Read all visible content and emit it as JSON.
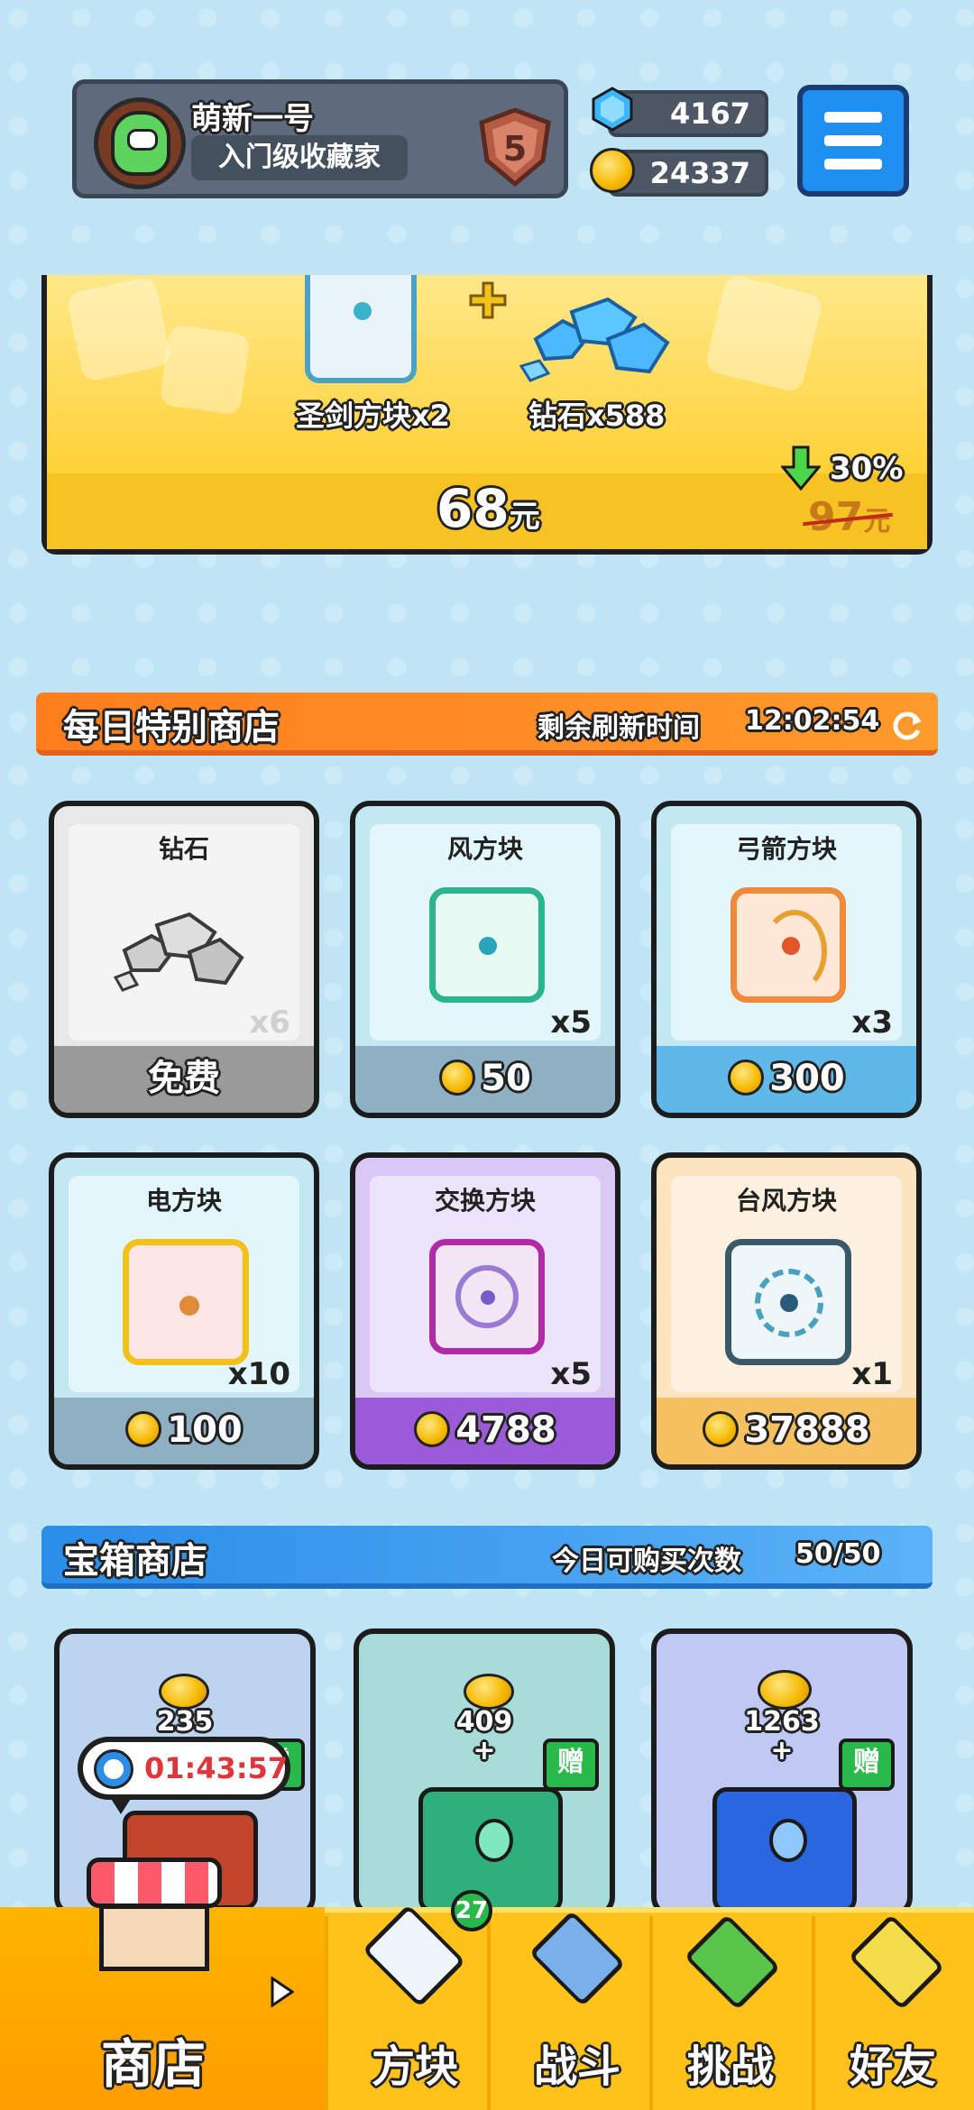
{
  "player": {
    "name": "萌新一号",
    "title": "入门级收藏家",
    "rank": "5"
  },
  "currency": {
    "gems": "4167",
    "coins": "24337"
  },
  "offer": {
    "item1_label": "圣剑方块x2",
    "item2_label": "钻石x588",
    "price": "68",
    "price_unit": "元",
    "discount": "30%",
    "old_price": "97",
    "old_price_unit": "元"
  },
  "daily_shop": {
    "title": "每日特别商店",
    "refresh_label": "剩余刷新时间",
    "refresh_time": "12:02:54",
    "items": [
      {
        "name": "钻石",
        "qty": "x6",
        "price": "免费"
      },
      {
        "name": "风方块",
        "qty": "x5",
        "price": "50"
      },
      {
        "name": "弓箭方块",
        "qty": "x3",
        "price": "300"
      },
      {
        "name": "电方块",
        "qty": "x10",
        "price": "100"
      },
      {
        "name": "交换方块",
        "qty": "x5",
        "price": "4788"
      },
      {
        "name": "台风方块",
        "qty": "x1",
        "price": "37888"
      }
    ]
  },
  "chest_shop": {
    "title": "宝箱商店",
    "purchases_label": "今日可购买次数",
    "purchases": "50/50",
    "chests": [
      {
        "coins": "235",
        "plus": "+",
        "gift": "赠"
      },
      {
        "coins": "409",
        "plus": "+",
        "gift": "赠"
      },
      {
        "coins": "1263",
        "plus": "+",
        "gift": "赠"
      }
    ],
    "timer": "01:43:57"
  },
  "nav": {
    "shop": "商店",
    "blocks": "方块",
    "blocks_badge": "27",
    "battle": "战斗",
    "challenge": "挑战",
    "friends": "好友"
  },
  "colors": {
    "accent_orange": "#ff8a24",
    "accent_blue": "#3a9cee",
    "gold": "#ffc21a"
  }
}
